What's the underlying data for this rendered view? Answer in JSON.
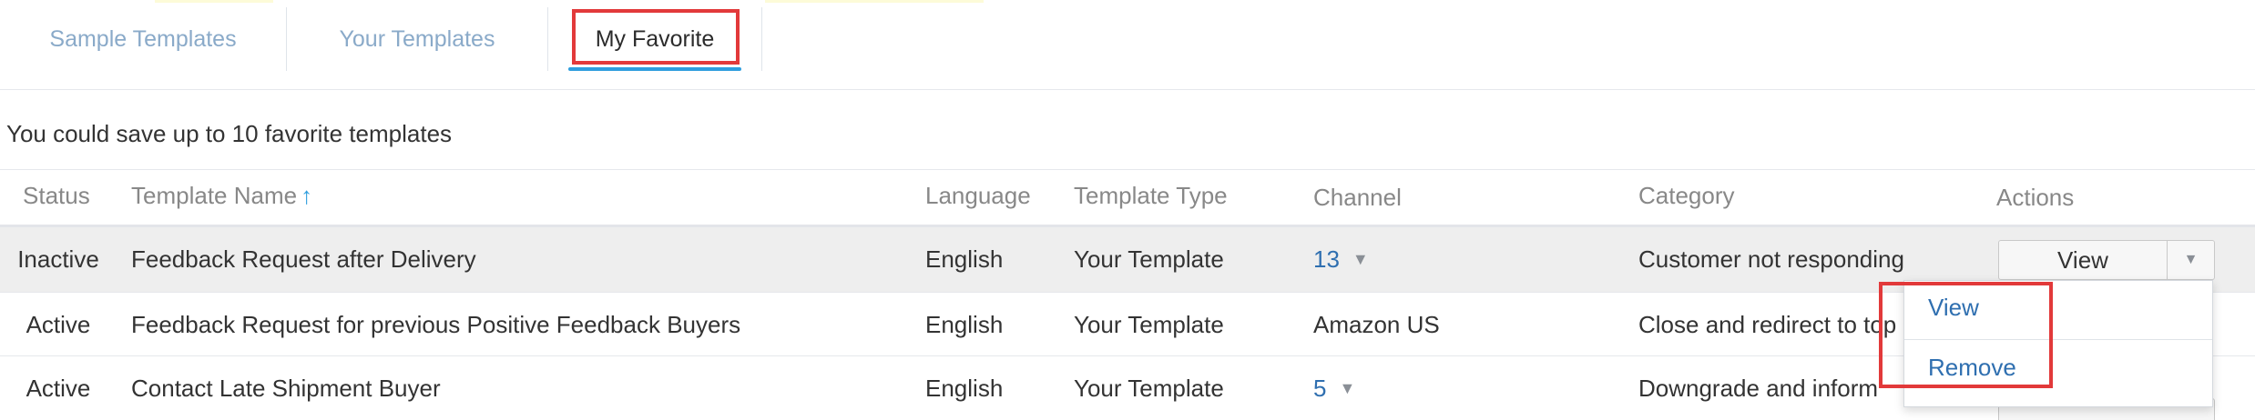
{
  "tabs": {
    "sample": "Sample Templates",
    "yours": "Your Templates",
    "favorite": "My Favorite"
  },
  "info": "You could save up to 10 favorite templates",
  "table": {
    "headers": {
      "status": "Status",
      "name": "Template Name",
      "language": "Language",
      "type": "Template Type",
      "channel": "Channel",
      "category": "Category",
      "actions": "Actions"
    },
    "sort_icon": "arrow-up-icon",
    "rows": [
      {
        "status": "Inactive",
        "name": "Feedback Request after Delivery",
        "language": "English",
        "type": "Your Template",
        "channel": "13",
        "category": "Customer not responding"
      },
      {
        "status": "Active",
        "name": "Feedback Request for previous Positive Feedback Buyers",
        "language": "English",
        "type": "Your Template",
        "channel": "Amazon US",
        "category": "Close and redirect to top"
      },
      {
        "status": "Active",
        "name": "Contact Late Shipment Buyer",
        "language": "English",
        "type": "Your Template",
        "channel": "5",
        "category": "Downgrade and inform"
      }
    ]
  },
  "actions": {
    "view_button": "View"
  },
  "menu": {
    "view": "View",
    "remove": "Remove"
  },
  "colors": {
    "accent": "#2f9ede",
    "link": "#2f6fb0",
    "highlight_box": "#e2393a",
    "row_highlight": "#eeeeee"
  }
}
